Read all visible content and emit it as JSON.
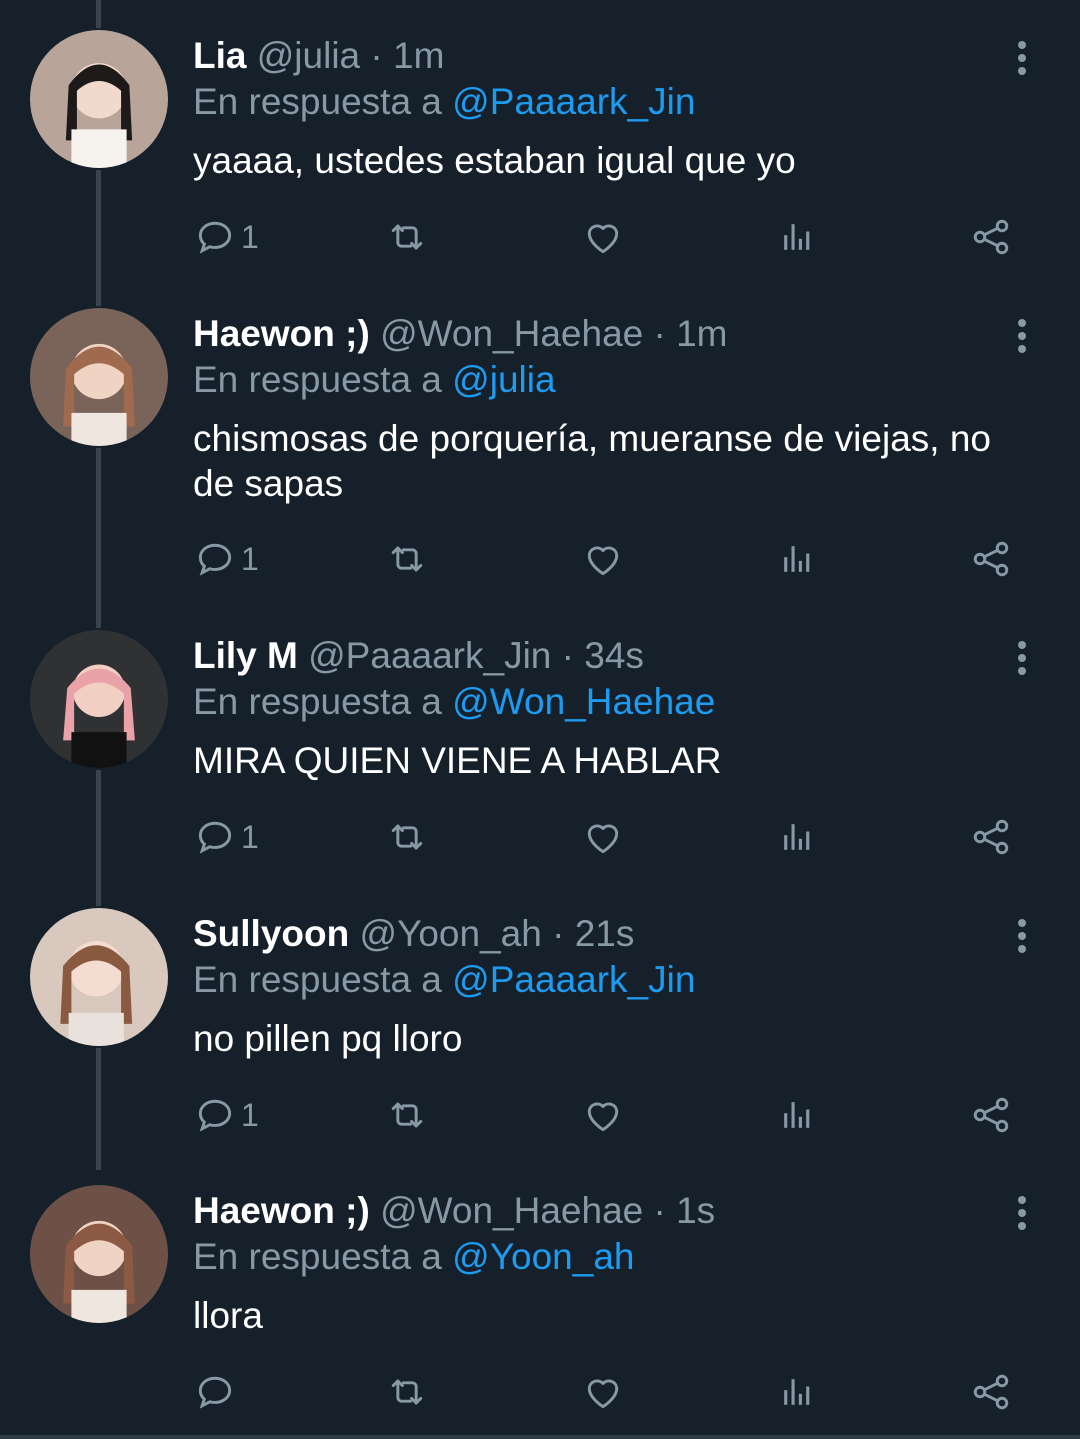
{
  "reply_prefix": "En respuesta a",
  "tweets": [
    {
      "name": "Lia",
      "handle": "@julia",
      "dot": "·",
      "time": "1m",
      "reply_to": "@Paaaark_Jin",
      "text": "yaaaa, ustedes estaban igual que yo",
      "reply_count": "1"
    },
    {
      "name": "Haewon ;)",
      "handle": "@Won_Haehae",
      "dot": "·",
      "time": "1m",
      "reply_to": "@julia",
      "text": "chismosas de porquería, mueranse de viejas, no de sapas",
      "reply_count": "1"
    },
    {
      "name": "Lily M",
      "handle": "@Paaaark_Jin",
      "dot": "·",
      "time": "34s",
      "reply_to": "@Won_Haehae",
      "text": "MIRA QUIEN VIENE A HABLAR",
      "reply_count": "1"
    },
    {
      "name": "Sullyoon",
      "handle": "@Yoon_ah",
      "dot": "·",
      "time": "21s",
      "reply_to": "@Paaaark_Jin",
      "text": "no pillen pq lloro",
      "reply_count": "1"
    },
    {
      "name": "Haewon ;)",
      "handle": "@Won_Haehae",
      "dot": "·",
      "time": "1s",
      "reply_to": "@Yoon_ah",
      "text": "llora",
      "reply_count": ""
    }
  ],
  "icons": {
    "reply": "reply-icon",
    "retweet": "retweet-icon",
    "like": "heart-icon",
    "views": "analytics-icon",
    "share": "share-icon",
    "more": "more-options-icon"
  },
  "colors": {
    "background": "#15202b",
    "muted": "#8899a6",
    "link": "#1d9bf0",
    "text": "#ffffff"
  }
}
